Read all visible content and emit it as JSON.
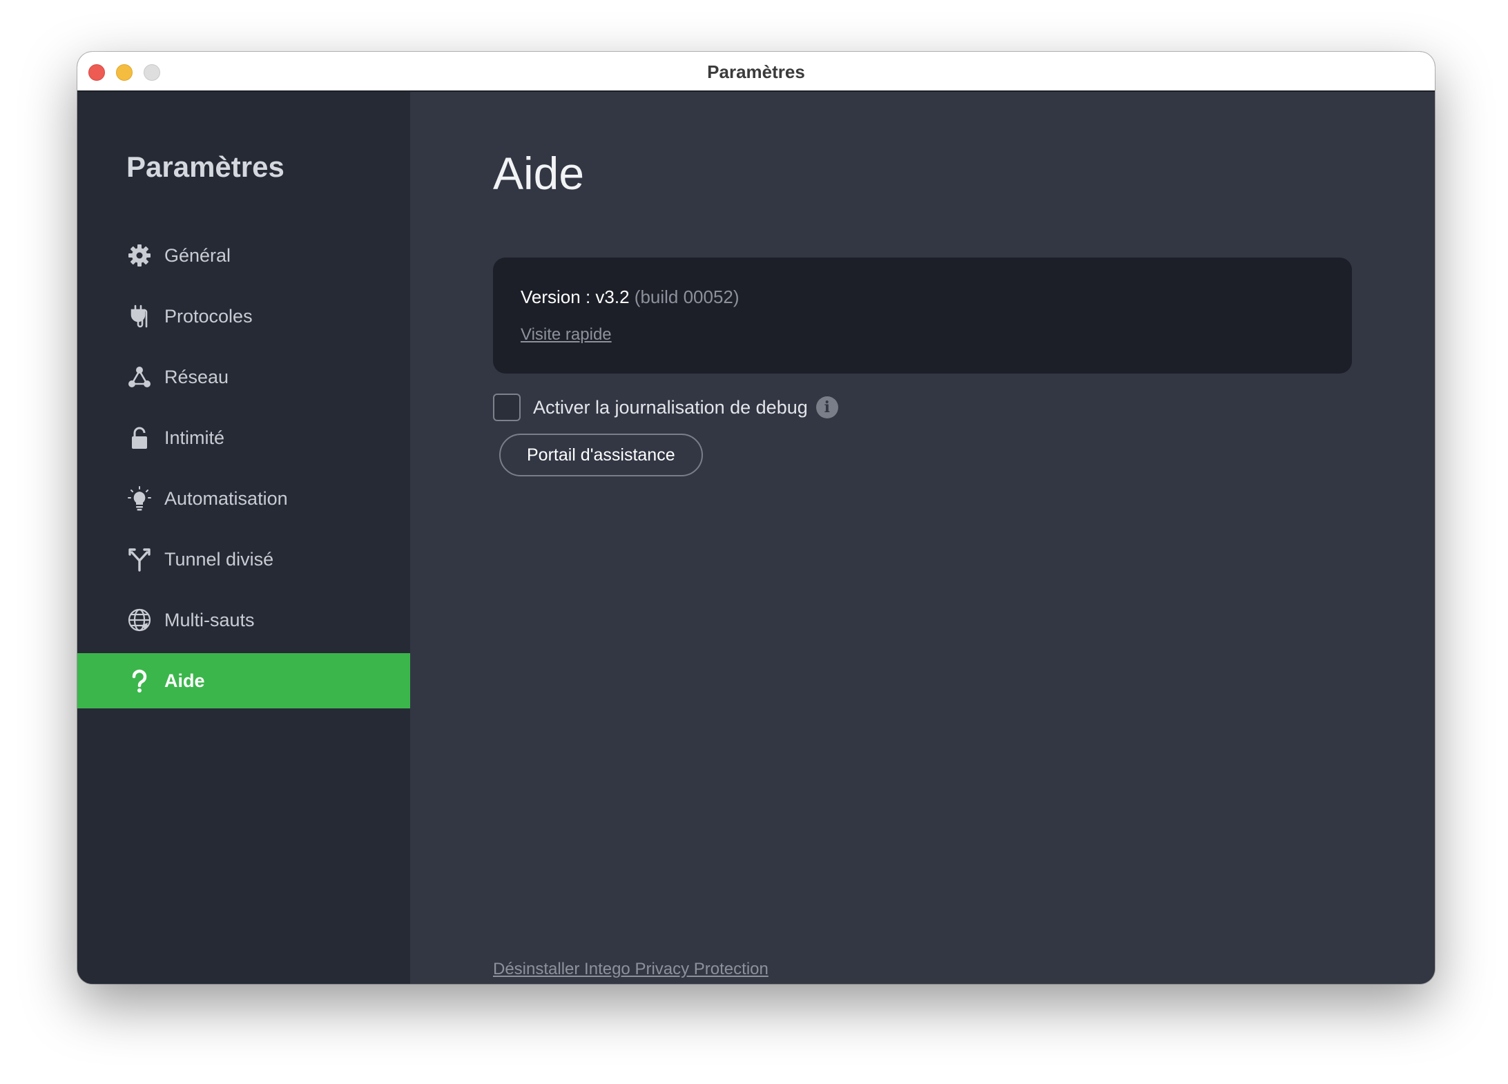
{
  "window": {
    "title": "Paramètres"
  },
  "sidebar": {
    "heading": "Paramètres",
    "items": [
      {
        "label": "Général",
        "icon": "gear-icon",
        "active": false
      },
      {
        "label": "Protocoles",
        "icon": "plug-icon",
        "active": false
      },
      {
        "label": "Réseau",
        "icon": "network-icon",
        "active": false
      },
      {
        "label": "Intimité",
        "icon": "lock-icon",
        "active": false
      },
      {
        "label": "Automatisation",
        "icon": "lightbulb-icon",
        "active": false
      },
      {
        "label": "Tunnel divisé",
        "icon": "split-arrow-icon",
        "active": false
      },
      {
        "label": "Multi-sauts",
        "icon": "globe-icon",
        "active": false
      },
      {
        "label": "Aide",
        "icon": "question-icon",
        "active": true
      }
    ]
  },
  "main": {
    "title": "Aide",
    "version": {
      "label": "Version : v3.2",
      "build": "(build 00052)",
      "tour_link": "Visite rapide"
    },
    "debug": {
      "label": "Activer la journalisation de debug",
      "checked": false
    },
    "support_button": "Portail d'assistance",
    "uninstall_link": "Désinstaller Intego Privacy Protection"
  },
  "colors": {
    "accent": "#3bb64b",
    "sidebar_bg": "#262a35",
    "main_bg": "#333744",
    "card_bg": "#1c1f27"
  }
}
